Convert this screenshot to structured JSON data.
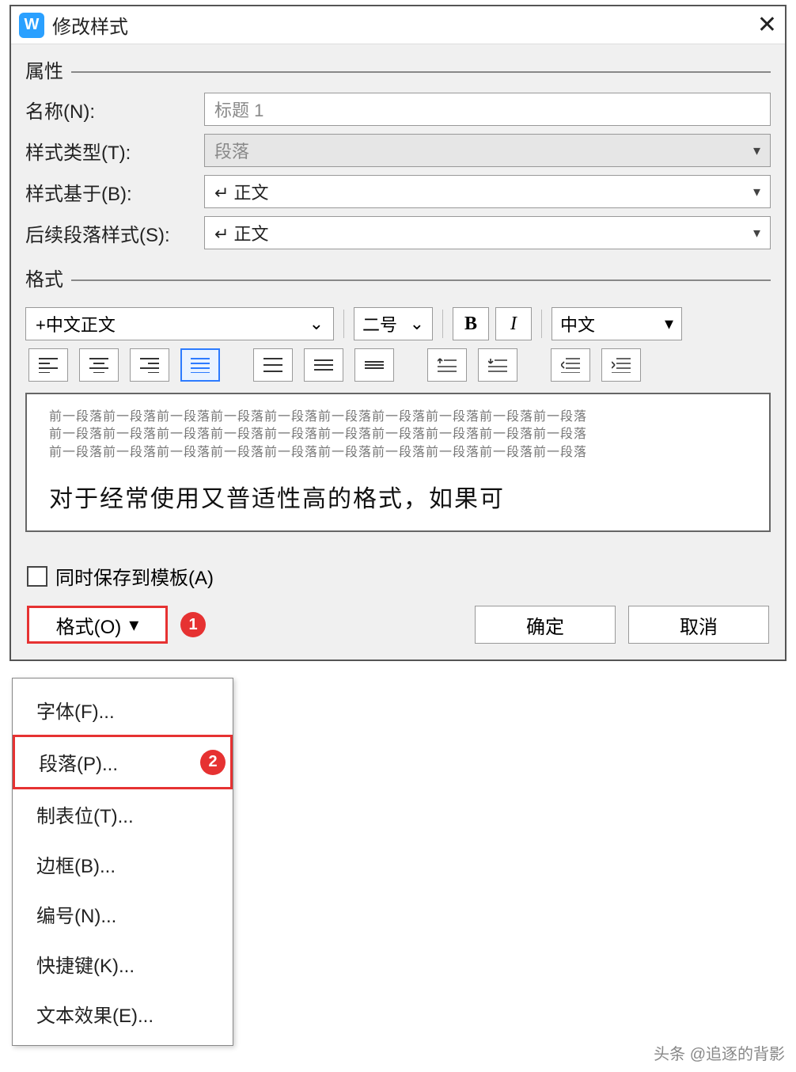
{
  "title": "修改样式",
  "sections": {
    "attr": "属性",
    "format": "格式"
  },
  "labels": {
    "name": "名称(N):",
    "type": "样式类型(T):",
    "base": "样式基于(B):",
    "next": "后续段落样式(S):"
  },
  "values": {
    "name": "标题 1",
    "type": "段落",
    "base": "↵ 正文",
    "next": "↵ 正文",
    "font": "+中文正文",
    "size": "二号",
    "lang": "中文",
    "bold": "B",
    "italic": "I"
  },
  "preview_line": "前一段落前一段落前一段落前一段落前一段落前一段落前一段落前一段落前一段落前一段落",
  "preview_sample": "对于经常使用又普适性高的格式，如果可",
  "checkbox_label": "同时保存到模板(A)",
  "format_btn": "格式(O)",
  "ok": "确定",
  "cancel": "取消",
  "badge1": "1",
  "badge2": "2",
  "dropdown": {
    "font": "字体(F)...",
    "para": "段落(P)...",
    "tabs": "制表位(T)...",
    "border": "边框(B)...",
    "number": "编号(N)...",
    "shortcut": "快捷键(K)...",
    "texteffect": "文本效果(E)..."
  },
  "watermark": "头条 @追逐的背影"
}
